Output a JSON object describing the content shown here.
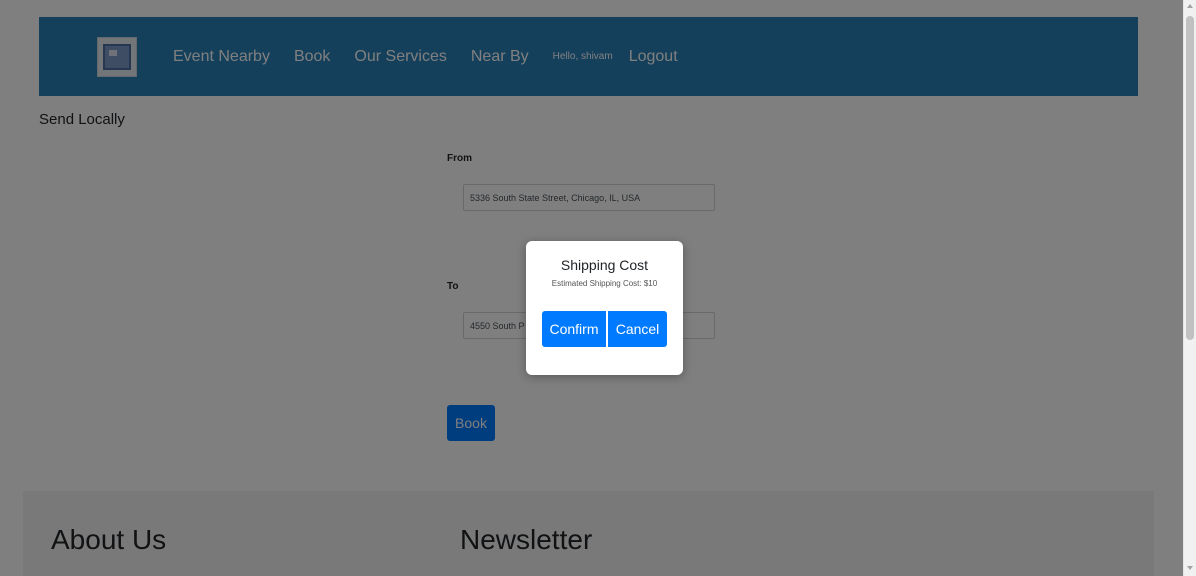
{
  "navbar": {
    "logo_icon": "parcel-truck-icon",
    "items": [
      "Event Nearby",
      "Book",
      "Our Services",
      "Near By"
    ],
    "greeting": "Hello, shivam",
    "logout": "Logout"
  },
  "page_title": "Send Locally",
  "form": {
    "from_label": "From",
    "from_value": "5336 South State Street, Chicago, IL, USA",
    "to_label": "To",
    "to_value": "4550 South P",
    "book_label": "Book"
  },
  "footer": {
    "about_heading": "About Us",
    "newsletter_heading": "Newsletter"
  },
  "modal": {
    "title": "Shipping Cost",
    "body": "Estimated Shipping Cost: $10",
    "confirm_label": "Confirm",
    "cancel_label": "Cancel"
  },
  "colors": {
    "navbar": "#2980b9",
    "primary_button": "#007bff",
    "overlay": "rgba(0,0,0,0.5)"
  }
}
